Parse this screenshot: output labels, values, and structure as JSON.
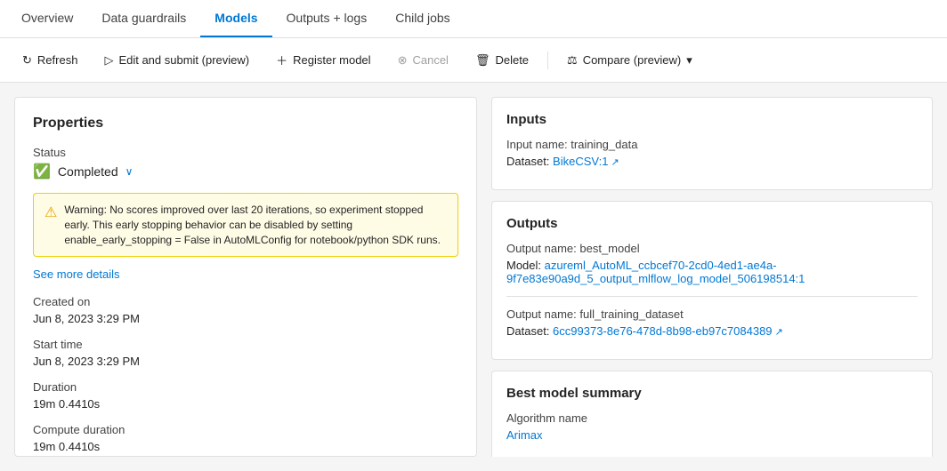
{
  "tabs": [
    {
      "id": "overview",
      "label": "Overview",
      "active": false
    },
    {
      "id": "data-guardrails",
      "label": "Data guardrails",
      "active": false
    },
    {
      "id": "models",
      "label": "Models",
      "active": true
    },
    {
      "id": "outputs-logs",
      "label": "Outputs + logs",
      "active": false
    },
    {
      "id": "child-jobs",
      "label": "Child jobs",
      "active": false
    }
  ],
  "toolbar": {
    "refresh_label": "Refresh",
    "edit_submit_label": "Edit and submit (preview)",
    "register_model_label": "Register model",
    "cancel_label": "Cancel",
    "delete_label": "Delete",
    "compare_label": "Compare (preview)"
  },
  "left_panel": {
    "title": "Properties",
    "status_label": "Status",
    "status_value": "Completed",
    "warning_text": "Warning: No scores improved over last 20 iterations, so experiment stopped early. This early stopping behavior can be disabled by setting enable_early_stopping = False in AutoMLConfig for notebook/python SDK runs.",
    "see_more_label": "See more details",
    "created_on_label": "Created on",
    "created_on_value": "Jun 8, 2023 3:29 PM",
    "start_time_label": "Start time",
    "start_time_value": "Jun 8, 2023 3:29 PM",
    "duration_label": "Duration",
    "duration_value": "19m 0.4410s",
    "compute_duration_label": "Compute duration",
    "compute_duration_value": "19m 0.4410s"
  },
  "right_panel": {
    "inputs": {
      "title": "Inputs",
      "input_name_label": "Input name: training_data",
      "dataset_label": "Dataset:",
      "dataset_link": "BikeCSV:1"
    },
    "outputs": {
      "title": "Outputs",
      "output1_name_label": "Output name: best_model",
      "model_label": "Model:",
      "model_link": "azureml_AutoML_ccbcef70-2cd0-4ed1-ae4a-9f7e83e90a9d_5_output_mlflow_log_model_506198514:1",
      "output2_name_label": "Output name: full_training_dataset",
      "dataset2_label": "Dataset:",
      "dataset2_link": "6cc99373-8e76-478d-8b98-eb97c7084389"
    },
    "best_model": {
      "title": "Best model summary",
      "algorithm_label": "Algorithm name",
      "algorithm_link": "Arimax"
    }
  }
}
